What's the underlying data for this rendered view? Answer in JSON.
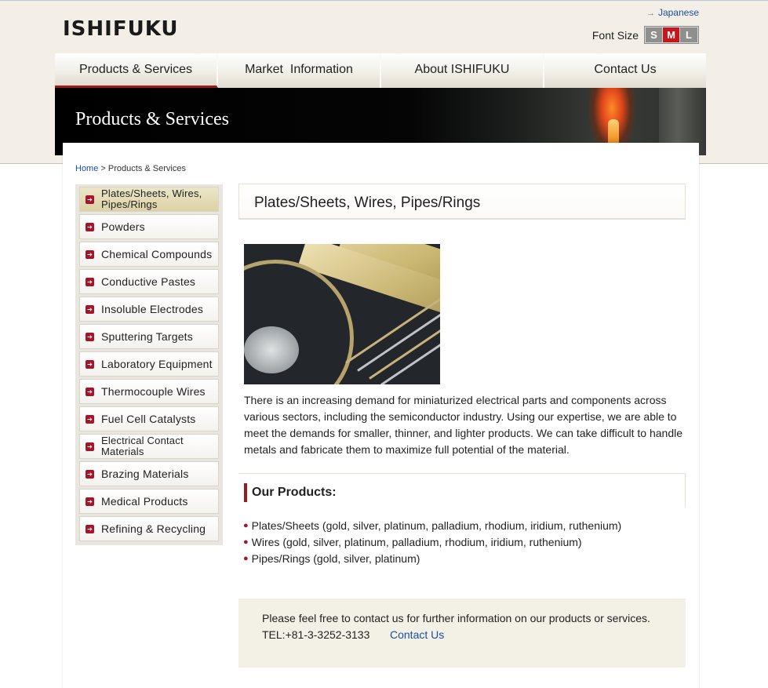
{
  "header": {
    "logo": "ISHIFUKU",
    "language_link": "Japanese",
    "font_size_label": "Font Size",
    "font_sizes": [
      "S",
      "M",
      "L"
    ],
    "font_size_selected": "M"
  },
  "nav": {
    "items": [
      "Products & Services",
      "Market  Information",
      "About ISHIFUKU",
      "Contact Us"
    ],
    "active": "Products & Services"
  },
  "banner": {
    "title": "Products & Services"
  },
  "breadcrumb": {
    "home": "Home",
    "separator": ">",
    "current": "Products & Services"
  },
  "sidebar": {
    "items": [
      "Plates/Sheets, Wires, Pipes/Rings",
      "Powders",
      "Chemical Compounds",
      "Conductive Pastes",
      "Insoluble Electrodes",
      "Sputtering Targets",
      "Laboratory Equipment",
      "Thermocouple Wires",
      "Fuel Cell Catalysts",
      "Electrical Contact Materials",
      "Brazing Materials",
      "Medical Products",
      "Refining & Recycling"
    ],
    "active": "Plates/Sheets, Wires, Pipes/Rings"
  },
  "main": {
    "heading": "Plates/Sheets, Wires, Pipes/Rings",
    "intro": "There is an increasing demand for miniaturized electrical parts and components across various sectors, including the semiconductor industry. Using our expertise, we are able to meet the demands for smaller, thinner, and lighter products. We can take difficult to handle metals and fabricate them to maximize full potential of the material.",
    "products_heading": "Our Products:",
    "products": [
      "Plates/Sheets (gold, silver, platinum, palladium, rhodium, iridium, ruthenium)",
      "Wires (gold, silver, platinum, palladium, rhodium, iridium, ruthenium)",
      "Pipes/Rings (gold, silver, platinum)"
    ]
  },
  "contact": {
    "text": "Please feel free to contact us for further information on our products or services.",
    "tel": "TEL:+81-3-3252-3133",
    "link": "Contact Us"
  },
  "colors": {
    "accent": "#9b1c1c",
    "link": "#1a4ea0",
    "background": "#f3efe6"
  }
}
